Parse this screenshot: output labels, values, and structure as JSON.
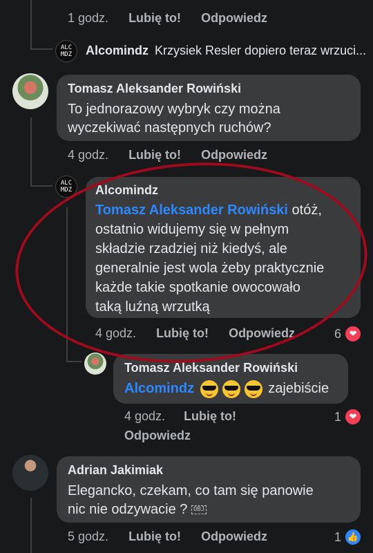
{
  "top_actions": {
    "time": "1 godz.",
    "like": "Lubię to!",
    "reply": "Odpowiedz"
  },
  "reply_preview": {
    "author": "Alcomindz",
    "text": "Krzysiek Resler dopiero teraz wrzuci..."
  },
  "comment_tomasz": {
    "author": "Tomasz Aleksander Rowiński",
    "text_line1": "To jednorazowy wybryk czy można",
    "text_line2": "wyczekiwać następnych ruchów?",
    "time": "4 godz.",
    "like": "Lubię to!",
    "reply": "Odpowiedz"
  },
  "reply_alcomindz": {
    "author": "Alcomindz",
    "mention": "Tomasz Aleksander Rowiński",
    "text_first": "otóż,",
    "line2": "ostatnio widujemy się w pełnym",
    "line3": "składzie rzadziej niż kiedyś, ale",
    "line4": "generalnie jest wola żeby praktycznie",
    "line5": "każde takie spotkanie owocowało",
    "line6": "taką luźną wrzutką",
    "time": "4 godz.",
    "like": "Lubię to!",
    "reply": "Odpowiedz",
    "reaction_count": "6"
  },
  "reply_tomasz": {
    "author": "Tomasz Aleksander Rowiński",
    "mention": "Alcomindz",
    "text": "zajebiście",
    "time": "4 godz.",
    "like": "Lubię to!",
    "reply": "Odpowiedz",
    "reaction_count": "1"
  },
  "comment_adrian": {
    "author": "Adrian Jakimiak",
    "text_line1": "Elegancko, czekam, co tam się panowie",
    "text_line2": "nic nie odzywacie ?",
    "obj_label": "OBJ",
    "time": "5 godz.",
    "like": "Lubię to!",
    "reply": "Odpowiedz",
    "reaction_count": "1"
  },
  "avatar_alc_text": "ALC MDZ",
  "colors": {
    "background": "#18191a",
    "bubble": "#3a3b3c",
    "mention": "#2d88ff",
    "heart": "#f33e58",
    "like": "#2d88ff",
    "annotation": "#9e0a1e"
  }
}
